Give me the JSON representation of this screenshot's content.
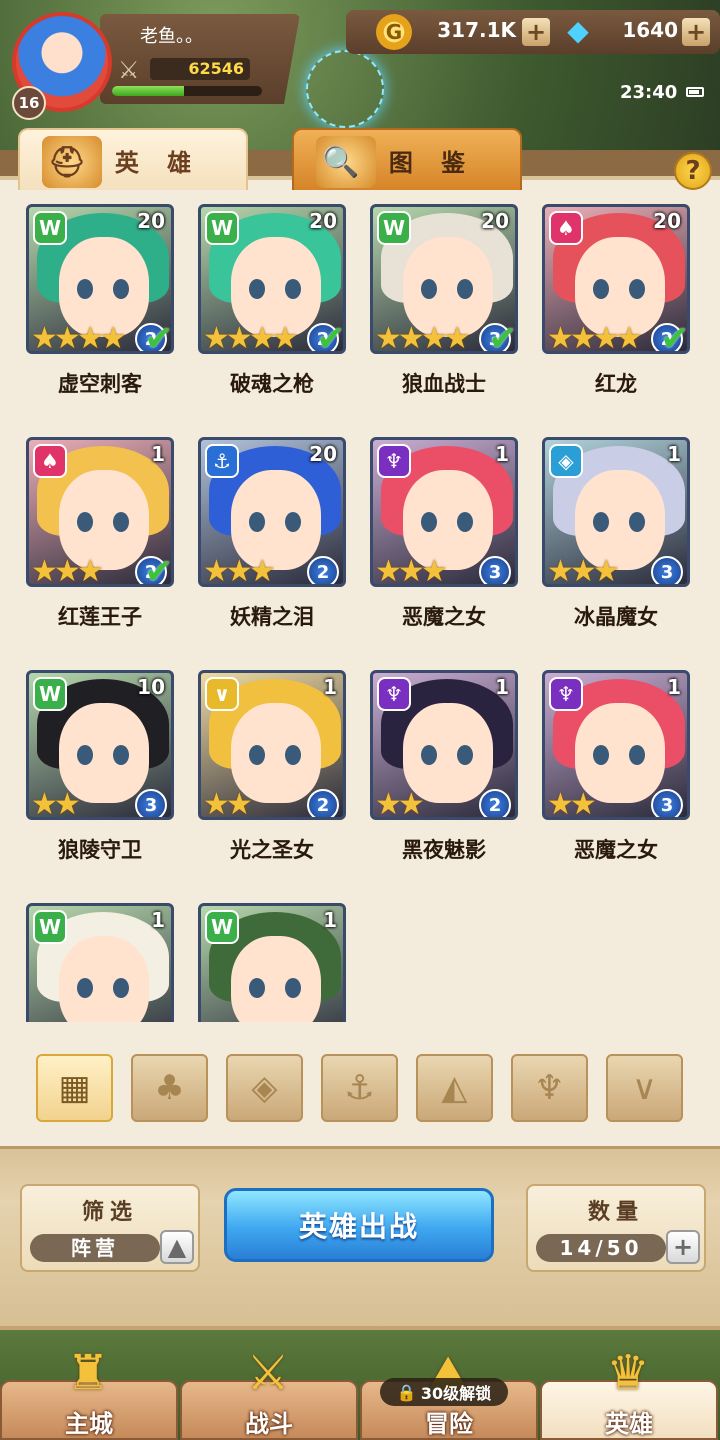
{
  "player": {
    "name": "老鱼。。",
    "level": "16",
    "power": "62546",
    "xp_fraction": 0.48
  },
  "currency": {
    "gold": "317.1K",
    "gems": "1640"
  },
  "status": {
    "time": "23:40"
  },
  "tabs": [
    {
      "label": "英 雄",
      "icon": "helmet-icon"
    },
    {
      "label": "图 鉴",
      "icon": "magnifier-icon"
    }
  ],
  "heroes": [
    {
      "name": "虚空刺客",
      "level": "20",
      "tier": "2",
      "stars": 4,
      "faction": "beast",
      "checked": true,
      "hair": "#2fae8a"
    },
    {
      "name": "破魂之枪",
      "level": "20",
      "tier": "2",
      "stars": 4,
      "faction": "beast",
      "checked": true,
      "hair": "#39c49a"
    },
    {
      "name": "狼血战士",
      "level": "20",
      "tier": "3",
      "stars": 4,
      "faction": "beast",
      "checked": true,
      "hair": "#e7e1d6"
    },
    {
      "name": "红龙",
      "level": "20",
      "tier": "2",
      "stars": 4,
      "faction": "flame",
      "checked": true,
      "hair": "#e6525c"
    },
    {
      "name": "红莲王子",
      "level": "1",
      "tier": "2",
      "stars": 3,
      "faction": "flame",
      "checked": true,
      "hair": "#f2c14e"
    },
    {
      "name": "妖精之泪",
      "level": "20",
      "tier": "2",
      "stars": 3,
      "faction": "anchor",
      "checked": false,
      "hair": "#2f5fd6"
    },
    {
      "name": "恶魔之女",
      "level": "1",
      "tier": "3",
      "stars": 3,
      "faction": "demon",
      "checked": false,
      "hair": "#ea4f67"
    },
    {
      "name": "冰晶魔女",
      "level": "1",
      "tier": "3",
      "stars": 3,
      "faction": "crystal",
      "checked": false,
      "hair": "#c9cde6"
    },
    {
      "name": "狼陵守卫",
      "level": "10",
      "tier": "3",
      "stars": 2,
      "faction": "beast",
      "checked": false,
      "hair": "#1f1f24"
    },
    {
      "name": "光之圣女",
      "level": "1",
      "tier": "2",
      "stars": 2,
      "faction": "light",
      "checked": false,
      "hair": "#f1c03e"
    },
    {
      "name": "黑夜魅影",
      "level": "1",
      "tier": "2",
      "stars": 2,
      "faction": "demon",
      "checked": false,
      "hair": "#2a2340"
    },
    {
      "name": "恶魔之女",
      "level": "1",
      "tier": "3",
      "stars": 2,
      "faction": "demon",
      "checked": false,
      "hair": "#ea4f67"
    },
    {
      "name": "",
      "level": "1",
      "tier": "",
      "stars": 0,
      "faction": "beast",
      "checked": false,
      "hair": "#f4efe3"
    },
    {
      "name": "",
      "level": "1",
      "tier": "",
      "stars": 0,
      "faction": "beast",
      "checked": false,
      "hair": "#3f6a3a"
    }
  ],
  "faction_colors": {
    "beast": "#3bb04a",
    "flame": "#e0336a",
    "anchor": "#2a6fd6",
    "demon": "#7a2fc0",
    "crystal": "#2a9fd6",
    "light": "#e8b92a"
  },
  "filters": [
    {
      "name": "all",
      "glyph": "▦",
      "active": true
    },
    {
      "name": "flame",
      "glyph": "♣",
      "active": false
    },
    {
      "name": "crystal",
      "glyph": "◈",
      "active": false
    },
    {
      "name": "anchor",
      "glyph": "⚓",
      "active": false
    },
    {
      "name": "beast",
      "glyph": "◭",
      "active": false
    },
    {
      "name": "demon",
      "glyph": "♆",
      "active": false
    },
    {
      "name": "light",
      "glyph": "∨",
      "active": false
    }
  ],
  "bottom": {
    "filter_title": "筛选",
    "filter_value": "阵营",
    "deploy_label": "英雄出战",
    "count_title": "数量",
    "count_value": "14/50"
  },
  "nav": [
    {
      "label": "主城",
      "icon": "castle-icon",
      "active": false
    },
    {
      "label": "战斗",
      "icon": "swords-icon",
      "active": false
    },
    {
      "label": "冒险",
      "icon": "map-icon",
      "active": false,
      "lock": "30级解锁"
    },
    {
      "label": "英雄",
      "icon": "hero-crest-icon",
      "active": true
    }
  ]
}
